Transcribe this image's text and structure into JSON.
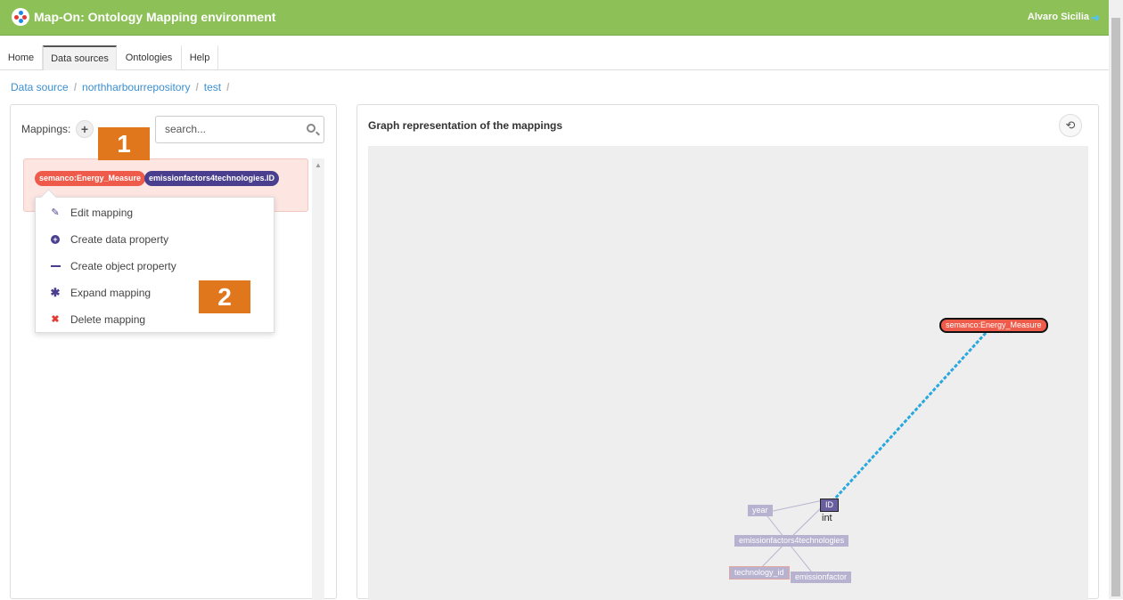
{
  "header": {
    "app_title": "Map-On: Ontology Mapping environment",
    "user_name": "Alvaro Sicilia"
  },
  "tabs": [
    {
      "label": "Home",
      "active": false
    },
    {
      "label": "Data sources",
      "active": true
    },
    {
      "label": "Ontologies",
      "active": false
    },
    {
      "label": "Help",
      "active": false
    }
  ],
  "breadcrumb": [
    "Data source",
    "northharbourrepository",
    "test"
  ],
  "left_panel": {
    "mappings_label": "Mappings:",
    "search_placeholder": "search...",
    "mapping": {
      "class_tag": "semanco:Energy_Measure",
      "table_tag": "emissionfactors4technologies.ID"
    },
    "context_menu": [
      {
        "label": "Edit mapping",
        "icon": "edit-icon"
      },
      {
        "label": "Create data property",
        "icon": "plus-circle-icon"
      },
      {
        "label": "Create object property",
        "icon": "dash-icon"
      },
      {
        "label": "Expand mapping",
        "icon": "asterisk-icon"
      },
      {
        "label": "Delete mapping",
        "icon": "close-icon"
      }
    ],
    "badges": [
      "1",
      "2"
    ]
  },
  "right_panel": {
    "title": "Graph representation of the mappings",
    "graph": {
      "class_node": "semanco:Energy_Measure",
      "id_node": "ID",
      "id_type": "int",
      "table_node": "emissionfactors4technologies",
      "column_nodes": [
        "year",
        "technology_id",
        "emissionfactor"
      ]
    }
  },
  "colors": {
    "header_green": "#8dc158",
    "class_red": "#ef5b4a",
    "table_purple": "#4a3f8f",
    "badge_orange": "#e0771d",
    "link_blue": "#29a8df"
  }
}
